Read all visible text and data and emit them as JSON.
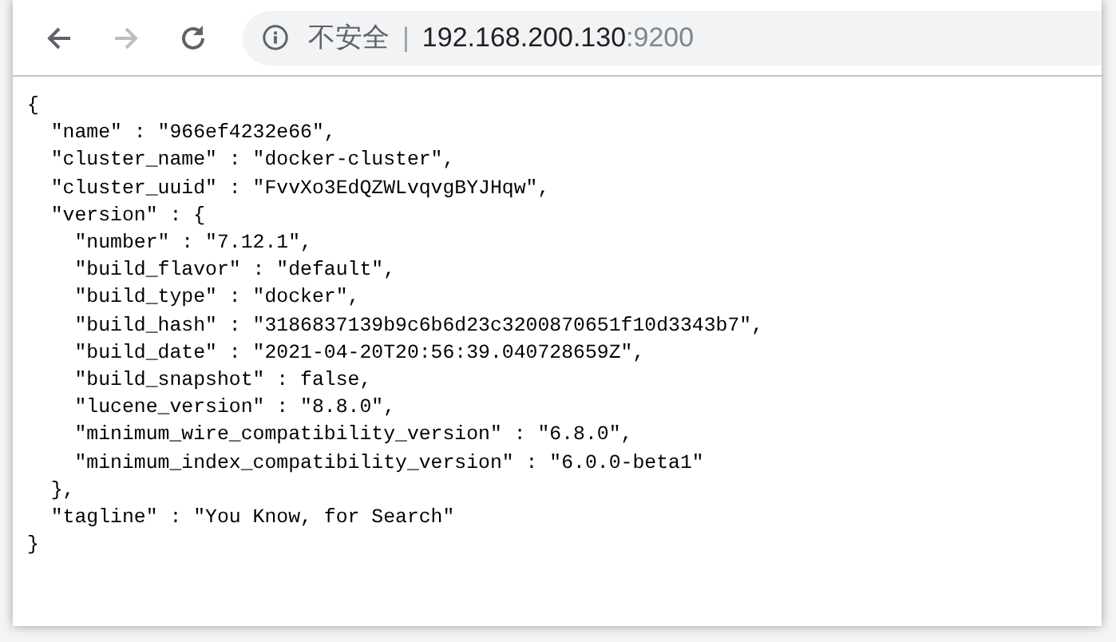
{
  "toolbar": {
    "buttons": [
      {
        "kind": "back",
        "disabled": false
      },
      {
        "kind": "forward",
        "disabled": true
      },
      {
        "kind": "reload",
        "disabled": false
      }
    ]
  },
  "address_bar": {
    "security_label": "不安全",
    "separator": "|",
    "host": "192.168.200.130",
    "port": ":9200"
  },
  "content": {
    "lines": [
      "{",
      "  \"name\" : \"966ef4232e66\",",
      "  \"cluster_name\" : \"docker-cluster\",",
      "  \"cluster_uuid\" : \"FvvXo3EdQZWLvqvgBYJHqw\",",
      "  \"version\" : {",
      "    \"number\" : \"7.12.1\",",
      "    \"build_flavor\" : \"default\",",
      "    \"build_type\" : \"docker\",",
      "    \"build_hash\" : \"3186837139b9c6b6d23c3200870651f10d3343b7\",",
      "    \"build_date\" : \"2021-04-20T20:56:39.040728659Z\",",
      "    \"build_snapshot\" : false,",
      "    \"lucene_version\" : \"8.8.0\",",
      "    \"minimum_wire_compatibility_version\" : \"6.8.0\",",
      "    \"minimum_index_compatibility_version\" : \"6.0.0-beta1\"",
      "  },",
      "  \"tagline\" : \"You Know, for Search\"",
      "}"
    ]
  }
}
